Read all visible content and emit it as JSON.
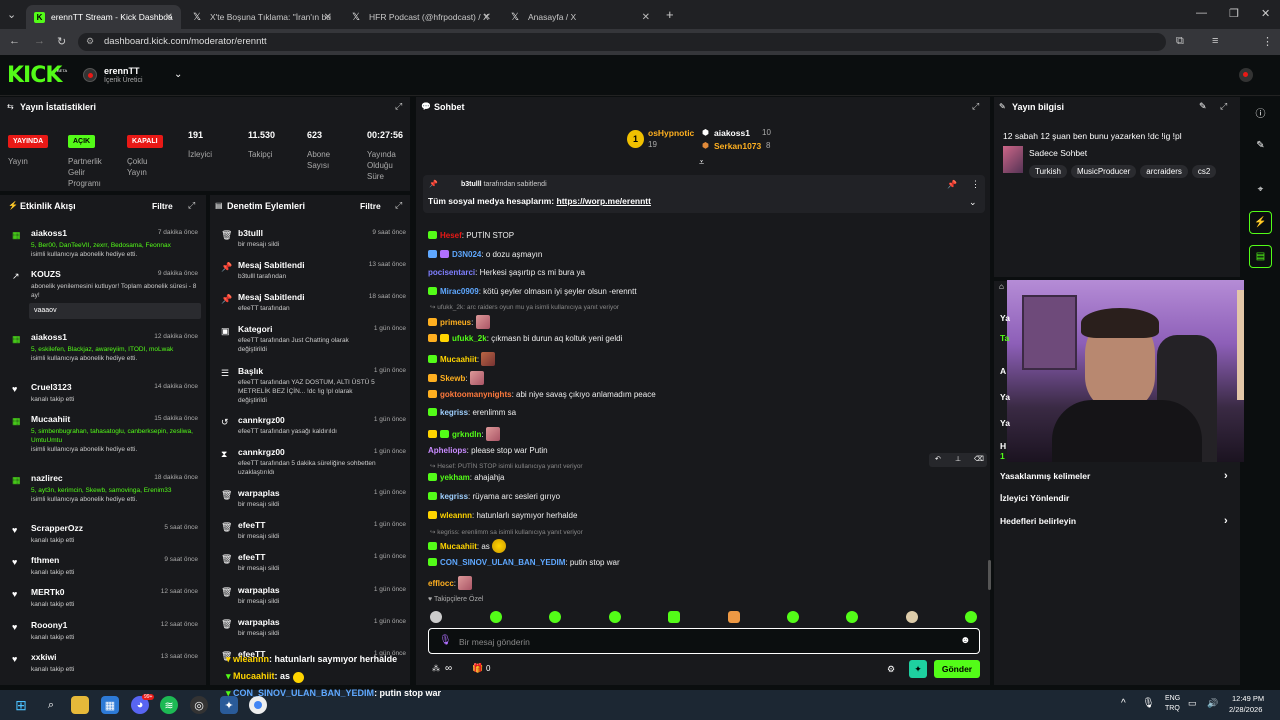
{
  "browser": {
    "tabs": [
      {
        "label": "erennTT Stream - Kick Dashboa",
        "icon": "kick-icon"
      },
      {
        "label": "X'te Boşuna Tıklama: \"İran'ın bu",
        "icon": "x-icon"
      },
      {
        "label": "HFR Podcast (@hfrpodcast) / X",
        "icon": "x-icon"
      },
      {
        "label": "Anasayfa / X",
        "icon": "x-icon"
      }
    ],
    "url": "dashboard.kick.com/moderator/erenntt"
  },
  "header": {
    "logo": "KICK",
    "beta": "BETA",
    "channel_name": "erennTT",
    "channel_role": "İçerik Üretici"
  },
  "stats": {
    "title": "Yayın İstatistikleri",
    "badges": [
      {
        "badge": "YAYINDA",
        "label": "Yayın",
        "color": "#e91916"
      },
      {
        "badge": "AÇIK",
        "label": "Partnerlik Gelir Programı",
        "color": "#53fc18"
      },
      {
        "badge": "KAPALI",
        "label": "Çoklu Yayın",
        "color": "#e91916"
      }
    ],
    "numbers": [
      {
        "value": "191",
        "label": "İzleyici"
      },
      {
        "value": "11.530",
        "label": "Takipçi"
      },
      {
        "value": "623",
        "label": "Abone Sayısı"
      },
      {
        "value": "00:27:56",
        "label": "Yayında Olduğu Süre"
      }
    ]
  },
  "activity": {
    "title": "Etkinlik Akışı",
    "filter": "Filtre",
    "items": [
      {
        "name": "aiakoss1",
        "time": "7 dakika önce",
        "desc1": "5, Ber00, DanTeeVII, zexrr, Bedosama, Feonnax",
        "desc2": "isimli kullanıcıya abonelik hediye etti."
      },
      {
        "name": "KOUZS",
        "time": "9 dakika önce",
        "desc1": "abonelik yenilemesini kutluyor! Toplam abonelik süresi - 8 ay!",
        "desc2": "",
        "message": "vaaaov"
      },
      {
        "name": "aiakoss1",
        "time": "12 dakika önce",
        "desc1": "5, eskilefen, Blackjaz, awareyiim, ITODI, moLwak",
        "desc2": "isimli kullanıcıya abonelik hediye etti."
      },
      {
        "name": "Cruel3123",
        "time": "14 dakika önce",
        "desc1": "kanalı takip etti",
        "desc2": ""
      },
      {
        "name": "Mucaahiit",
        "time": "15 dakika önce",
        "desc1": "5, simbenbugrahan, tahasatoglu, canberksepin, zesliwa, UmtuUmtu",
        "desc2": "isimli kullanıcıya abonelik hediye etti."
      },
      {
        "name": "nazlirec",
        "time": "18 dakika önce",
        "desc1": "5, ayt3n, kerimcin, Skewb, samovinga, Erenim33",
        "desc2": "isimli kullanıcıya abonelik hediye etti."
      },
      {
        "name": "ScrapperOzz",
        "time": "5 saat önce",
        "desc1": "kanalı takip etti",
        "desc2": ""
      },
      {
        "name": "fthmen",
        "time": "9 saat önce",
        "desc1": "kanalı takip etti",
        "desc2": ""
      },
      {
        "name": "MERTk0",
        "time": "12 saat önce",
        "desc1": "kanalı takip etti",
        "desc2": ""
      },
      {
        "name": "Rooony1",
        "time": "12 saat önce",
        "desc1": "kanalı takip etti",
        "desc2": ""
      },
      {
        "name": "xxkiwi",
        "time": "13 saat önce",
        "desc1": "kanalı takip etti",
        "desc2": ""
      }
    ]
  },
  "moderation": {
    "title": "Denetim Eylemleri",
    "filter": "Filtre",
    "items": [
      {
        "name": "b3tulll",
        "time": "9 saat önce",
        "desc": "bir mesajı sildi"
      },
      {
        "name": "Mesaj Sabitlendi",
        "time": "13 saat önce",
        "desc": "b3tulll tarafından"
      },
      {
        "name": "Mesaj Sabitlendi",
        "time": "18 saat önce",
        "desc": "efeeTT tarafından"
      },
      {
        "name": "Kategori",
        "time": "1 gün önce",
        "desc": "efeeTT tarafından Just Chatting olarak değiştirildi"
      },
      {
        "name": "Başlık",
        "time": "1 gün önce",
        "desc": "efeeTT tarafından YAZ DOSTUM, ALTI ÜSTÜ 5 METRELİK BEZ İÇİN... !dc !ig !pl olarak değiştirildi"
      },
      {
        "name": "cannkrgz00",
        "time": "1 gün önce",
        "desc": "efeeTT tarafından yasağı kaldırıldı"
      },
      {
        "name": "cannkrgz00",
        "time": "1 gün önce",
        "desc": "efeeTT tarafından 5 dakika süreliğine sohbetten uzaklaştırıldı"
      },
      {
        "name": "warpaplas",
        "time": "1 gün önce",
        "desc": "bir mesajı sildi"
      },
      {
        "name": "efeeTT",
        "time": "1 gün önce",
        "desc": "bir mesajı sildi"
      },
      {
        "name": "efeeTT",
        "time": "1 gün önce",
        "desc": "bir mesajı sildi"
      },
      {
        "name": "warpaplas",
        "time": "1 gün önce",
        "desc": "bir mesajı sildi"
      },
      {
        "name": "warpaplas",
        "time": "1 gün önce",
        "desc": "bir mesajı sildi"
      },
      {
        "name": "efeeTT",
        "time": "1 gün önce",
        "desc": ""
      }
    ]
  },
  "chat": {
    "title": "Sohbet",
    "leaders": [
      {
        "name": "osHypnotic",
        "count": "19",
        "rank": "1"
      },
      {
        "name": "aiakoss1",
        "count": "10"
      },
      {
        "name": "Serkan1073",
        "count": "8"
      }
    ],
    "pinned_by_user": "b3tulll",
    "pinned_by": "tarafından sabitlendi",
    "pinned_text": "Tüm sosyal medya hesaplarım:",
    "pinned_link": "https://worp.me/erenntt",
    "messages": [
      {
        "user": "Hesef",
        "color": "#e91916",
        "text": "PUTİN STOP"
      },
      {
        "user": "D3N024",
        "color": "#5fa8ff",
        "text": "o dozu aşmayın"
      },
      {
        "user": "pocisentarci",
        "color": "#7f7fff",
        "text": "Herkesi şaşırtıp cs mi bura ya"
      },
      {
        "user": "Mirac0909",
        "color": "#5fa8ff",
        "text": "kötü şeyler olmasın iyi şeyler olsun -erenntt"
      },
      {
        "reply": "ufukk_2k: arc raiders oyun mu ya isimli kullanıcıya yanıt veriyor"
      },
      {
        "user": "primeus",
        "color": "#ffb020",
        "text": ""
      },
      {
        "user": "ufukk_2k",
        "color": "#53fc18",
        "text": "çıkmasn bi durun aq koltuk yeni geldi"
      },
      {
        "user": "Mucaahiit",
        "color": "#ffd400",
        "text": ""
      },
      {
        "user": "Skewb",
        "color": "#ffb020",
        "text": ""
      },
      {
        "user": "goktoomanynights",
        "color": "#ff7a3d",
        "text": "abi niye savaş çıkıyo anlamadım peace"
      },
      {
        "user": "kegriss",
        "color": "#9fd0ff",
        "text": "erenlimm sa"
      },
      {
        "user": "grkndln",
        "color": "#53fc18",
        "text": ""
      },
      {
        "user": "Apheliops",
        "color": "#c98bff",
        "text": "please stop war Putin"
      },
      {
        "reply": "Hesef: PUTİN STOP isimli kullanıcıya yanıt veriyor"
      },
      {
        "user": "yekham",
        "color": "#53fc18",
        "text": "ahajahja"
      },
      {
        "user": "kegriss",
        "color": "#9fd0ff",
        "text": "rüyama arc sesleri gırıyo"
      },
      {
        "user": "wleannn",
        "color": "#ffd400",
        "text": "hatunlarlı saymıyor herhalde"
      },
      {
        "reply": "kegriss: erenlimm sa isimli kullanıcıya yanıt veriyor"
      },
      {
        "user": "Mucaahiit",
        "color": "#ffd400",
        "text": "as"
      },
      {
        "user": "CON_SINOV_ULAN_BAN_YEDIM",
        "color": "#5fa8ff",
        "text": "putin stop war"
      },
      {
        "user": "efflocc",
        "color": "#ffb020",
        "text": ""
      }
    ],
    "emote_section": "Takipçilere Özel",
    "input_placeholder": "Bir mesaj gönderin",
    "points": "∞",
    "gifts": "0",
    "send": "Gönder"
  },
  "stream_info": {
    "title": "Yayın bilgisi",
    "stream_title": "12 sabah 12 şuan ben bunu yazarken !dc !ig !pl",
    "category": "Sadece Sohbet",
    "tags": [
      "Turkish",
      "MusicProducer",
      "arcraiders",
      "cs2"
    ],
    "menu": [
      {
        "label": "Yasaklanmış kelimeler",
        "chevron": true
      },
      {
        "label": "İzleyici Yönlendir",
        "chevron": false
      },
      {
        "label": "Hedefleri belirleyin",
        "chevron": true
      }
    ]
  },
  "overlay_chat": [
    {
      "user": "wleannn",
      "text": ": hatunlarlı saymıyor herhalde",
      "color": "#ffd400"
    },
    {
      "user": "Mucaahiit",
      "text": ": as",
      "color": "#ffd400"
    },
    {
      "user": "CON_SINOV_ULAN_BAN_YEDIM",
      "text": ": putin stop war",
      "color": "#5fa8ff"
    }
  ],
  "taskbar": {
    "lang1": "ENG",
    "lang2": "TRQ",
    "time": "12:49 PM",
    "date": "2/28/2026",
    "badge": "99+"
  }
}
